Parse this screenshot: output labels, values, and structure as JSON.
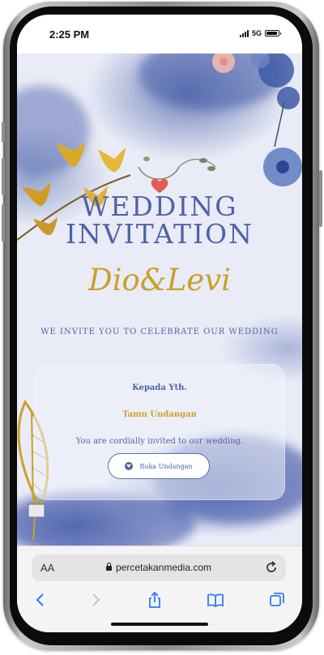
{
  "status_bar": {
    "time": "2:25 PM",
    "network": "5G",
    "battery_level": 0.9
  },
  "invitation": {
    "title_line1": "WEDDING",
    "title_line2": "INVITATION",
    "couple_names": "Dio&Levi",
    "invite_text": "WE INVITE YOU TO CELEBRATE OUR WEDDING",
    "card": {
      "salutation": "Kepada Yth.",
      "guest_name": "Tamu Undangan",
      "message": "You are cordially invited to our wedding.",
      "open_button_label": "Buka Undangan",
      "open_button_icon": "chevron-down-circle-icon"
    },
    "colors": {
      "primary_blue": "#4e63a7",
      "gold": "#c9a12a",
      "background": "#e9ebf6"
    }
  },
  "browser": {
    "text_size_label": "AA",
    "url": "percetakanmedia.com",
    "icons": [
      "lock-icon",
      "reload-icon",
      "back-icon",
      "forward-icon",
      "share-icon",
      "bookmarks-icon",
      "tabs-icon"
    ]
  }
}
